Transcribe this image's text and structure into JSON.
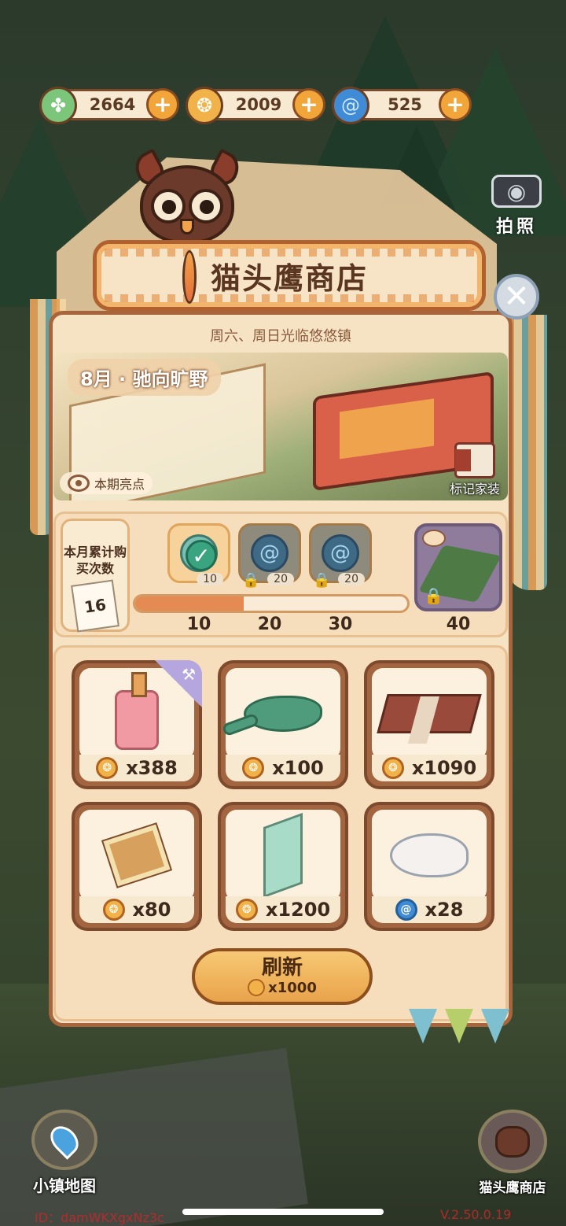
{
  "currencies": [
    {
      "name": "clover",
      "icon": "clover-icon",
      "value": "2664",
      "color": "#7bc67b"
    },
    {
      "name": "coin",
      "icon": "coin-icon",
      "value": "2009",
      "color": "#f2b24a"
    },
    {
      "name": "swirl",
      "icon": "swirl-icon",
      "value": "525",
      "color": "#3f8bd6"
    }
  ],
  "camera": {
    "label": "拍照"
  },
  "shop": {
    "title": "猫头鹰商店",
    "subtitle": "周六、周日光临悠悠镇",
    "banner": {
      "tag": "8月 · 驰向旷野",
      "highlight_label": "本期亮点",
      "mark_label": "标记家装"
    },
    "monthly": {
      "label": "本月累计购买次数",
      "count": "16",
      "progress_fraction": 0.4,
      "rewards": [
        {
          "state": "claimed",
          "qty": "10"
        },
        {
          "state": "locked",
          "qty": "20"
        },
        {
          "state": "locked",
          "qty": "20"
        }
      ],
      "ticks": [
        "10",
        "20",
        "30",
        "40"
      ]
    },
    "items": [
      {
        "art": "soap-bottle",
        "price": "x388",
        "currency": "coin",
        "badge": true
      },
      {
        "art": "lizard",
        "price": "x100",
        "currency": "coin",
        "badge": false
      },
      {
        "art": "table",
        "price": "x1090",
        "currency": "coin",
        "badge": false
      },
      {
        "art": "painting",
        "price": "x80",
        "currency": "coin",
        "badge": false
      },
      {
        "art": "screen",
        "price": "x1200",
        "currency": "coin",
        "badge": false
      },
      {
        "art": "polar-bear",
        "price": "x28",
        "currency": "swirl",
        "badge": false
      }
    ],
    "refresh": {
      "label": "刷新",
      "cost": "x1000"
    }
  },
  "nav": {
    "map_label": "小镇地图",
    "shop_label": "猫头鹰商店"
  },
  "footer": {
    "id": "ID：damWKXgxNz3c",
    "version": "V.2.50.0.19"
  }
}
